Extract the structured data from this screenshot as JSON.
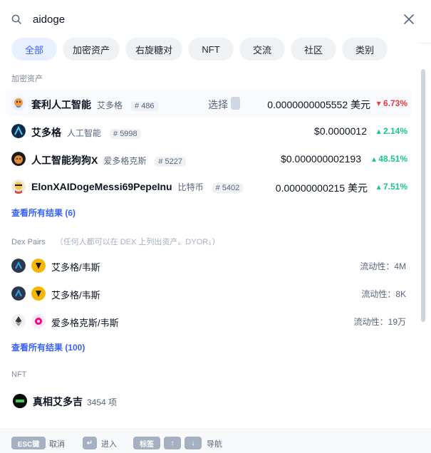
{
  "search": {
    "value": "aidoge",
    "icons": {
      "search": "search-icon",
      "close": "close-icon"
    }
  },
  "tabs": [
    {
      "label": "全部",
      "active": true
    },
    {
      "label": "加密资产"
    },
    {
      "label": "右旋糖对"
    },
    {
      "label": "NFT"
    },
    {
      "label": "交流"
    },
    {
      "label": "社区"
    },
    {
      "label": "类别"
    }
  ],
  "crypto": {
    "title": "加密资产",
    "select_label": "选择",
    "items": [
      {
        "name": "套利人工智能",
        "symbol": "艾多格",
        "rank": "# 486",
        "price": "0.0000000005552 美元",
        "change": "6.73%",
        "direction": "down"
      },
      {
        "name": "艾多格",
        "symbol": "人工智能",
        "rank": "# 5998",
        "price": "$0.0000012",
        "change": "2.14%",
        "direction": "up"
      },
      {
        "name": "人工智能狗狗X",
        "symbol": "爱多格克斯",
        "rank": "# 5227",
        "price": "$0.000000002193",
        "change": "48.51%",
        "direction": "up"
      },
      {
        "name": "ElonXAIDogeMessi69PepeInu",
        "symbol": "比特币",
        "rank": "# 5402",
        "price": "0.00000000215 美元",
        "change": "7.51%",
        "direction": "up"
      }
    ],
    "see_all": "查看所有结果 (6)"
  },
  "dex": {
    "title": "Dex Pairs",
    "note": "（任何人都可以在 DEX 上列出资产。DYOR。）",
    "items": [
      {
        "name": "艾多格/韦斯",
        "liquidity": "流动性：4M"
      },
      {
        "name": "艾多格/韦斯",
        "liquidity": "流动性：8K"
      },
      {
        "name": "爱多格克斯/韦斯",
        "liquidity": "流动性：19万"
      }
    ],
    "see_all": "查看所有结果 (100)"
  },
  "nft": {
    "title": "NFT",
    "items": [
      {
        "name": "真相艾多吉",
        "count": "3454 项"
      }
    ]
  },
  "footer": {
    "esc_key": "ESC键",
    "esc_label": "取消",
    "enter_label": "进入",
    "tab_key": "标签",
    "nav_label": "导航"
  },
  "colors": {
    "accent": "#3861fb",
    "up": "#16c784",
    "down": "#ea3943"
  }
}
